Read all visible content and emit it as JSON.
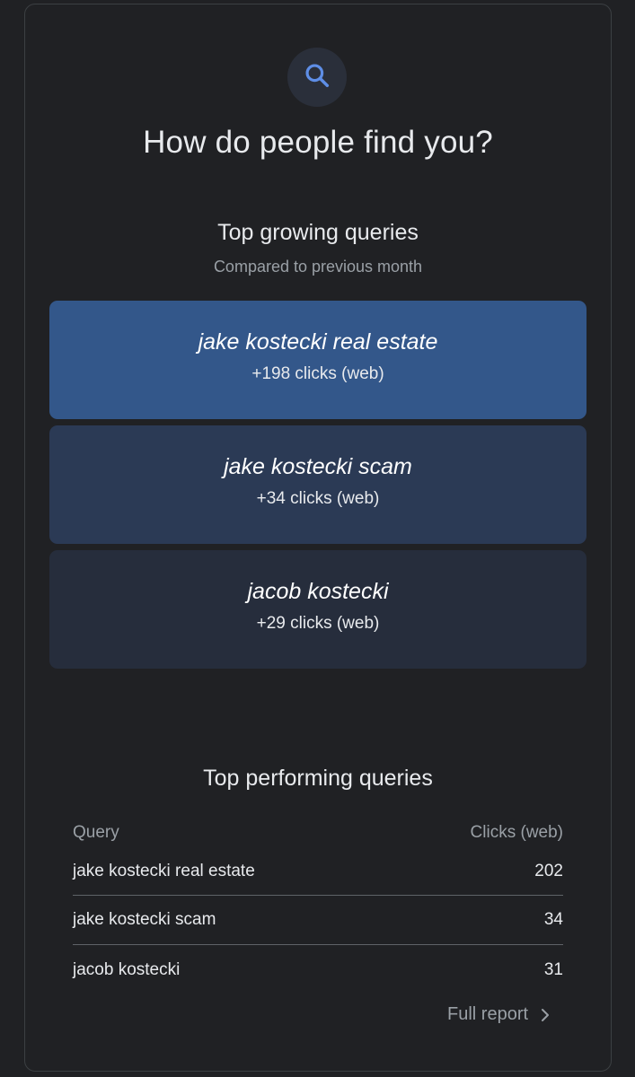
{
  "header": {
    "icon": "search-icon",
    "title": "How do people find you?"
  },
  "growing": {
    "title": "Top growing queries",
    "subtitle": "Compared to previous month",
    "items": [
      {
        "query": "jake kostecki real estate",
        "clicks": "+198 clicks (web)"
      },
      {
        "query": "jake kostecki scam",
        "clicks": "+34 clicks (web)"
      },
      {
        "query": "jacob kostecki",
        "clicks": "+29 clicks (web)"
      }
    ]
  },
  "performing": {
    "title": "Top performing queries",
    "columns": {
      "query": "Query",
      "clicks": "Clicks (web)"
    },
    "rows": [
      {
        "query": "jake kostecki real estate",
        "clicks": "202"
      },
      {
        "query": "jake kostecki scam",
        "clicks": "34"
      },
      {
        "query": "jacob kostecki",
        "clicks": "31"
      }
    ],
    "link_label": "Full report",
    "link_icon": "chevron-right-icon"
  },
  "colors": {
    "background": "#202124",
    "accent": "#5e8ee6",
    "card_1": "#33578a",
    "card_2": "#2b3a55",
    "card_3": "#262d3c"
  }
}
